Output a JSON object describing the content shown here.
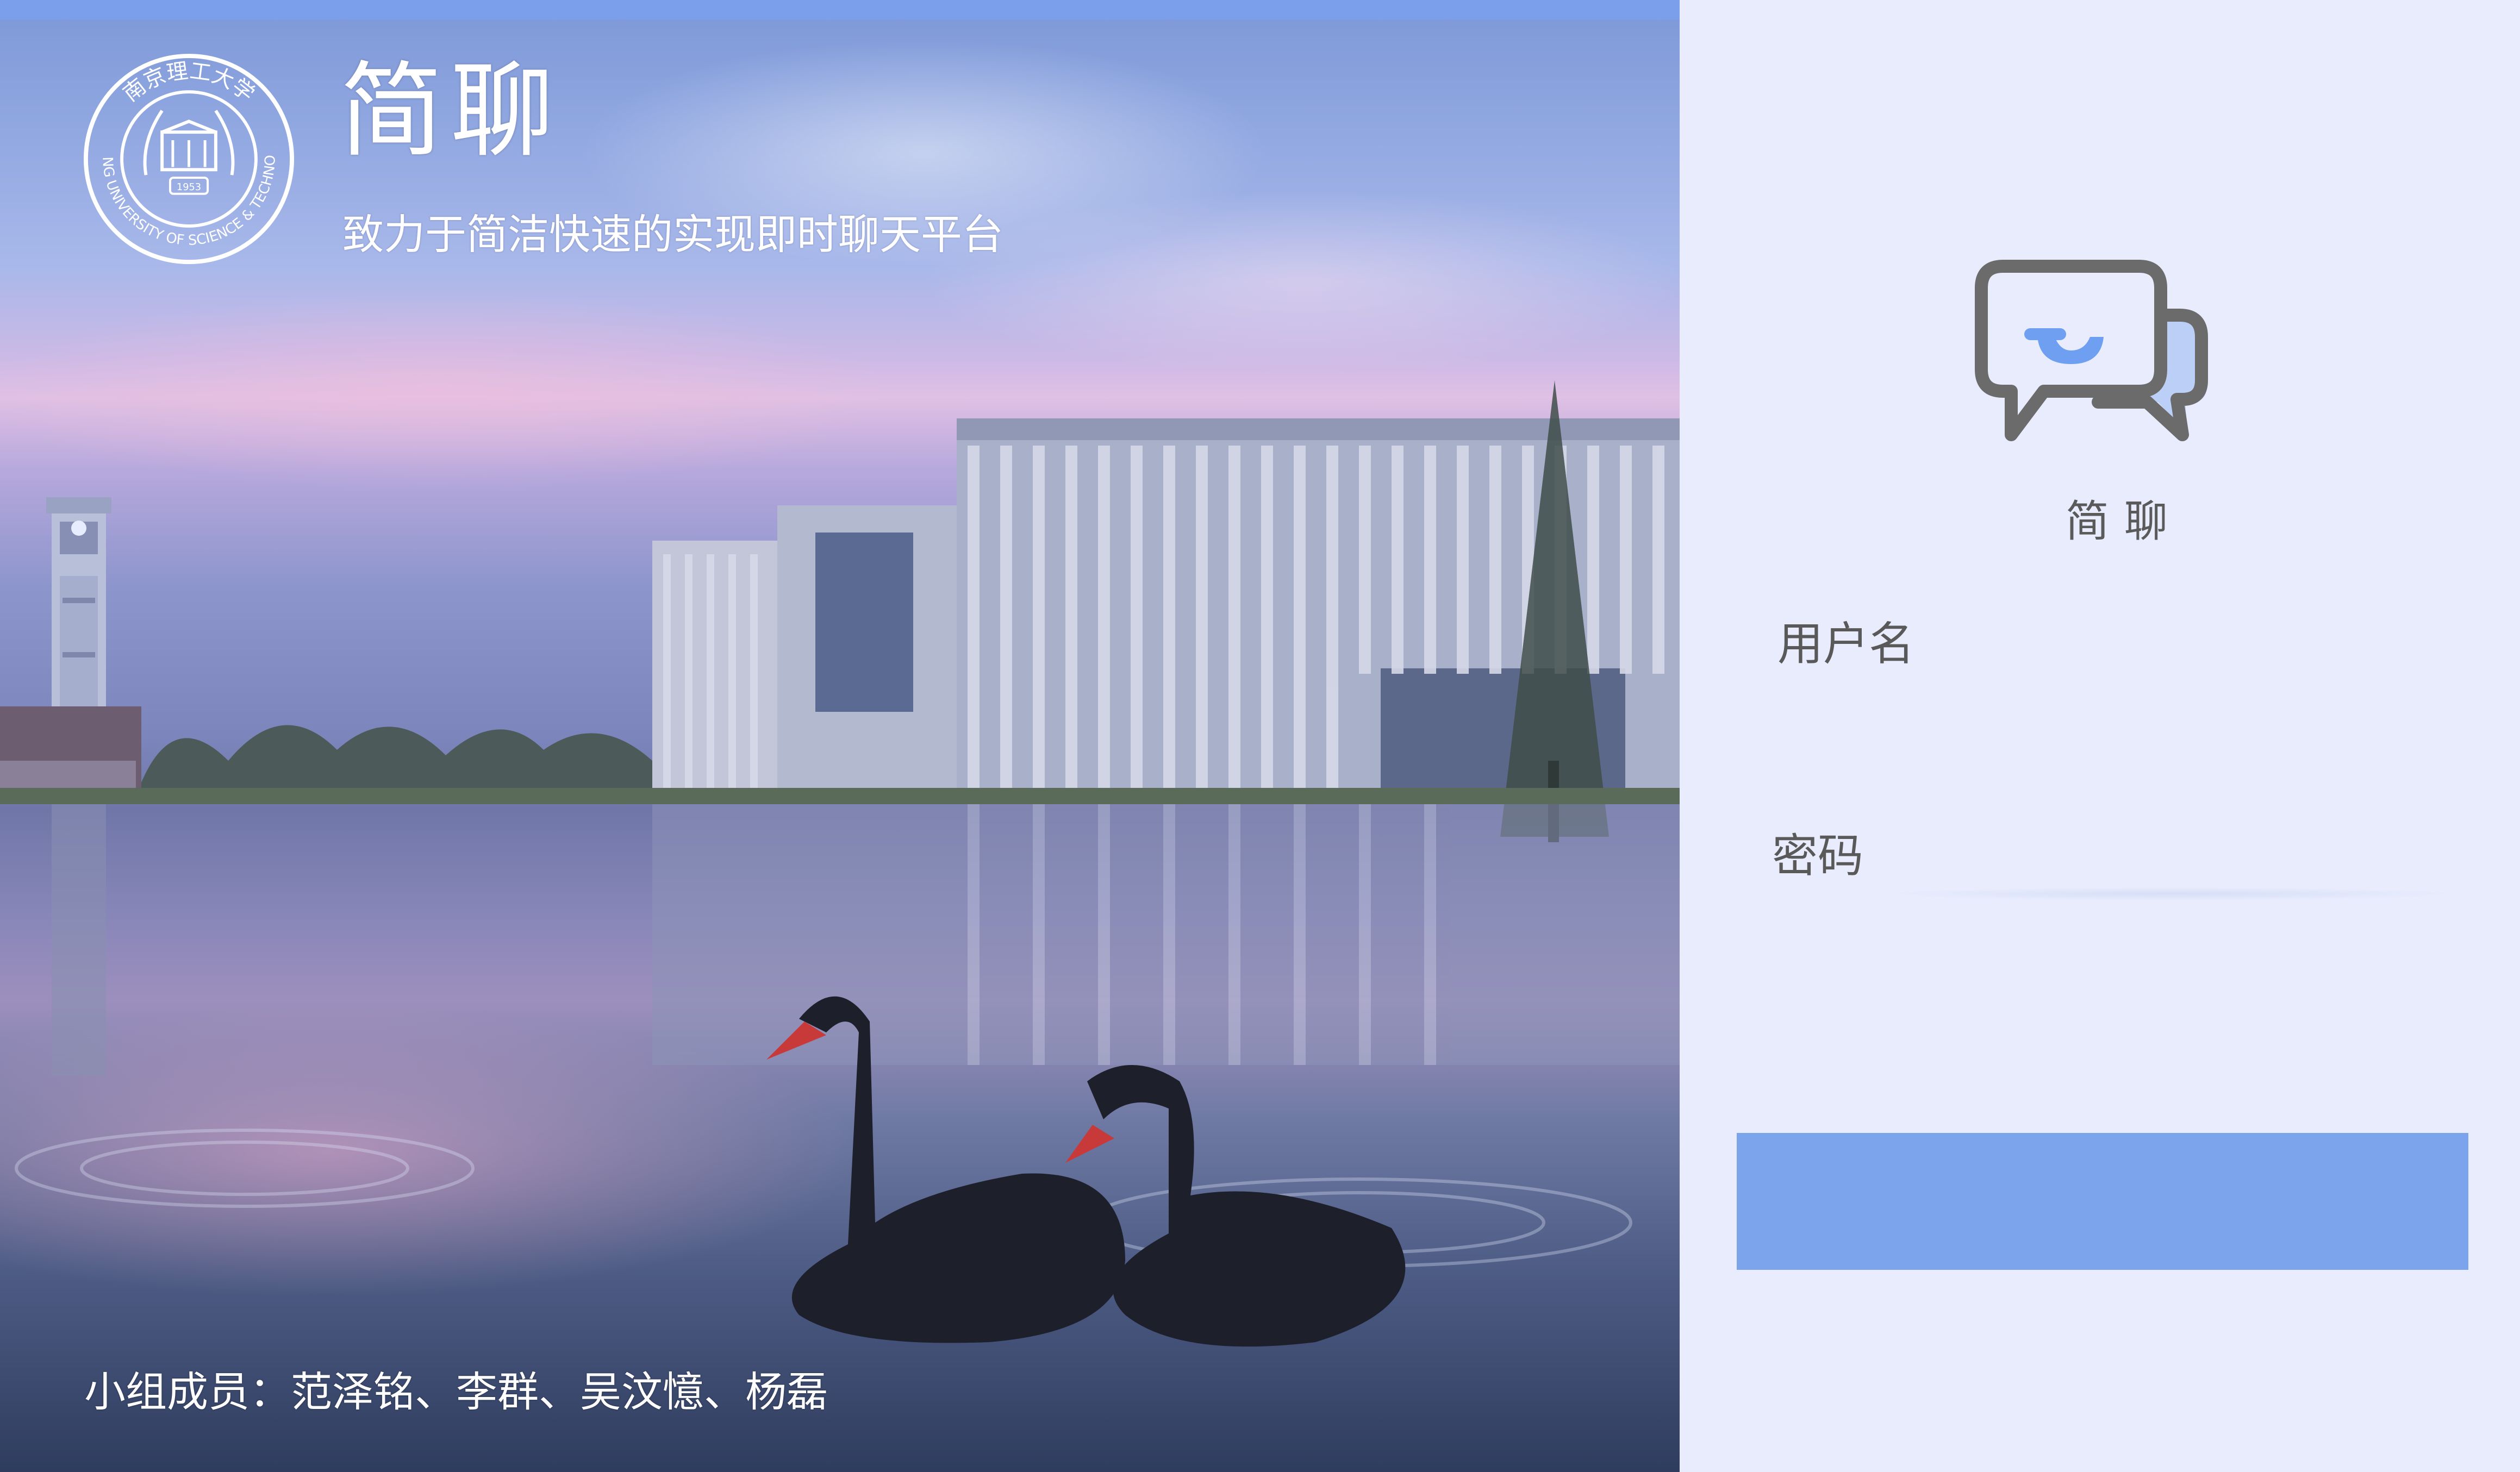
{
  "header": {
    "app_title": "简聊",
    "subtitle": "致力于简洁快速的实现即时聊天平台"
  },
  "footer": {
    "team_members": "小组成员：范泽铭、李群、吴汶憶、杨磊"
  },
  "university_seal": {
    "icon": "university-seal-icon",
    "ring_text": "NANJING UNIVERSITY OF SCIENCE & TECHNOLOGY",
    "top_text": "南京理工大学",
    "year": "1953"
  },
  "login": {
    "brand_name": "简聊",
    "logo_icon": "chat-bubbles-icon",
    "username_label": "用户名",
    "username_value": "",
    "password_label": "密码",
    "password_value": "",
    "submit_label": ""
  },
  "colors": {
    "accent": "#7ba4ec",
    "panel_background": "#e8ecfd",
    "label_text": "#595959",
    "logo_gray": "#6b6b6b",
    "logo_blue": "#6f9ff0"
  }
}
